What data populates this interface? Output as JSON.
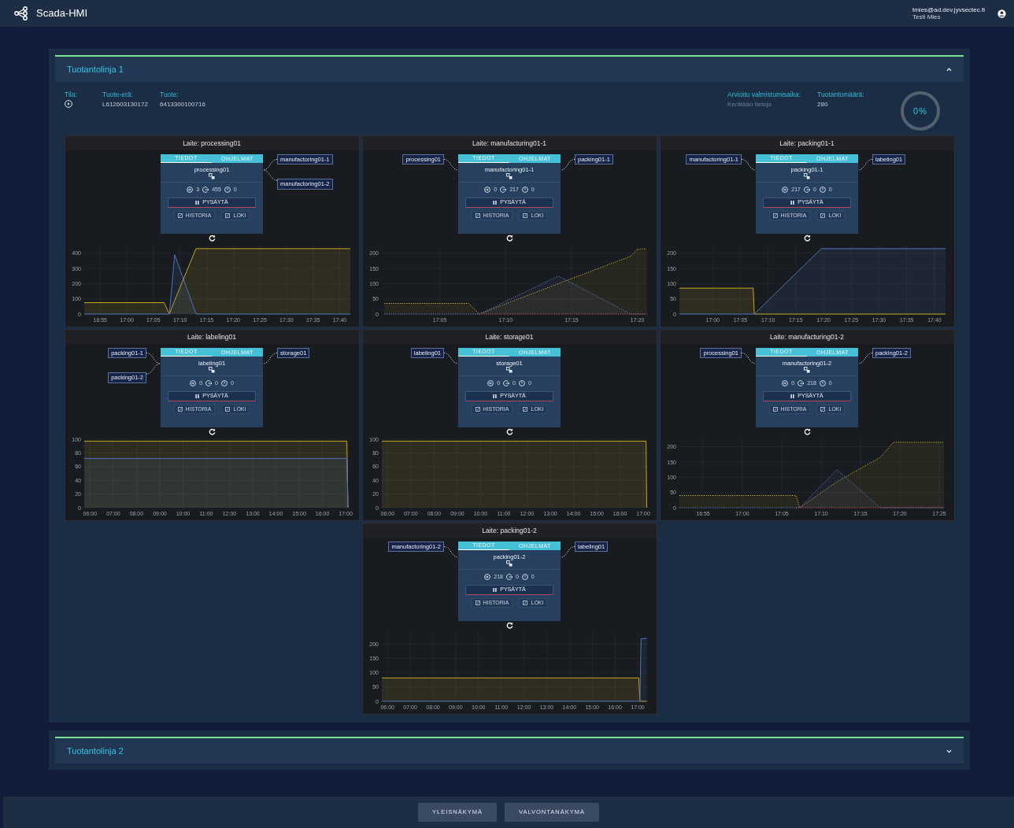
{
  "app": {
    "title": "Scada-HMI"
  },
  "user": {
    "email": "tmies@ad.dev.jyvsectec.fi",
    "name": "Testi Mies"
  },
  "lines": [
    {
      "title": "Tuotantolinja 1",
      "expanded": true,
      "info": {
        "status_label": "Tila:",
        "batch_label": "Tuote-erä:",
        "batch": "L612603130172",
        "product_label": "Tuote:",
        "product": "6413300100716",
        "eta_label": "Arvioitu valmistumisaika:",
        "eta": "Kerätään tietoja",
        "amount_label": "Tuotantomäärä:",
        "amount": "280",
        "progress": {
          "text": "0%"
        }
      },
      "devices": [
        {
          "title": "Laite: processing01",
          "name": "processing01",
          "tabs": [
            {
              "label": "TIEDOT",
              "selected": true
            },
            {
              "label": "OHJELMAT",
              "selected": false
            }
          ],
          "outputs": [
            "manufactoring01-1",
            "manufactoring01-2"
          ],
          "counts": [
            "3",
            "455",
            "0"
          ],
          "stop_button": "PYSÄYTÄ",
          "buttons": [
            "HISTORIA",
            "LOKI"
          ],
          "chart_data": {
            "type": "area",
            "grid": true,
            "x": [
              16.8667,
              17.1167,
              17.1333,
              17.15,
              17.2167,
              17.7
            ],
            "xlim": [
              16.8667,
              17.7
            ],
            "ylim": [
              0,
              450
            ],
            "yticks": [
              0,
              100,
              200,
              300,
              400
            ],
            "xticks": [
              {
                "value": 16.9167,
                "label": "16:55"
              },
              {
                "value": 17,
                "label": "17:00"
              },
              {
                "value": 17.0833,
                "label": "17:05"
              },
              {
                "value": 17.1667,
                "label": "17:10"
              },
              {
                "value": 17.25,
                "label": "17:15"
              },
              {
                "value": 17.3333,
                "label": "17:20"
              },
              {
                "value": 17.4167,
                "label": "17:25"
              },
              {
                "value": 17.5,
                "label": "17:30"
              },
              {
                "value": 17.5833,
                "label": "17:35"
              },
              {
                "value": 17.6667,
                "label": "17:40"
              }
            ],
            "series": [
              {
                "color": "#c9a820",
                "values": [
                  75,
                  75,
                  0,
                  90,
                  430,
                  430
                ]
              },
              {
                "color": "#4d74b8",
                "values": [
                  0,
                  0,
                  0,
                  390,
                  0,
                  0
                ]
              }
            ]
          }
        },
        {
          "title": "Laite: manufacturing01-1",
          "name": "manufactoring01-1",
          "tabs": [
            {
              "label": "TIEDOT",
              "selected": true
            },
            {
              "label": "OHJELMAT",
              "selected": false
            }
          ],
          "inputs": [
            "processing01"
          ],
          "outputs": [
            "packing01-1"
          ],
          "counts": [
            "0",
            "217",
            "0"
          ],
          "stop_button": "PYSÄYTÄ",
          "buttons": [
            "HISTORIA",
            "LOKI"
          ],
          "chart_data": {
            "type": "line",
            "grid": true,
            "x": [
              17.0133,
              17.12,
              17.1333,
              17.2333,
              17.325,
              17.3333,
              17.345
            ],
            "xlim": [
              17.01,
              17.3467
            ],
            "ylim": [
              0,
              225
            ],
            "yticks": [
              0,
              50,
              100,
              150,
              200
            ],
            "xticks": [
              {
                "value": 17.0833,
                "label": "17:05"
              },
              {
                "value": 17.1667,
                "label": "17:10"
              },
              {
                "value": 17.25,
                "label": "17:15"
              },
              {
                "value": 17.3333,
                "label": "17:20"
              }
            ],
            "series": [
              {
                "color": "#d4b62a",
                "line_style": "dotted",
                "values": [
                  35,
                  35,
                  0,
                  100,
                  190,
                  213,
                  215
                ]
              },
              {
                "color": "#5a82c8",
                "line_style": "dotted",
                "values": [
                  0,
                  0,
                  0,
                  125,
                  0,
                  0,
                  0
                ]
              },
              {
                "color": "#d05050",
                "line_style": "dotted",
                "values": [
                  null,
                  null,
                  0,
                  0,
                  0,
                  0,
                  0
                ]
              }
            ]
          }
        },
        {
          "title": "Laite: packing01-1",
          "name": "packing01-1",
          "tabs": [
            {
              "label": "TIEDOT",
              "selected": true
            },
            {
              "label": "OHJELMAT",
              "selected": false
            }
          ],
          "inputs": [
            "manufactoring01-1"
          ],
          "outputs": [
            "labeling01"
          ],
          "counts": [
            "217",
            "0",
            "0"
          ],
          "stop_button": "PYSÄYTÄ",
          "buttons": [
            "HISTORIA",
            "LOKI"
          ],
          "chart_data": {
            "type": "area",
            "grid": true,
            "x": [
              16.9,
              17.1217,
              17.125,
              17.3267,
              17.7
            ],
            "xlim": [
              16.9,
              17.7
            ],
            "ylim": [
              0,
              225
            ],
            "yticks": [
              0,
              50,
              100,
              150,
              200
            ],
            "xticks": [
              {
                "value": 17,
                "label": "17:00"
              },
              {
                "value": 17.0833,
                "label": "17:05"
              },
              {
                "value": 17.1667,
                "label": "17:10"
              },
              {
                "value": 17.25,
                "label": "17:15"
              },
              {
                "value": 17.3333,
                "label": "17:20"
              },
              {
                "value": 17.4167,
                "label": "17:25"
              },
              {
                "value": 17.5,
                "label": "17:30"
              },
              {
                "value": 17.5833,
                "label": "17:35"
              },
              {
                "value": 17.6667,
                "label": "17:40"
              }
            ],
            "series": [
              {
                "color": "#c9a820",
                "values": [
                  85,
                  85,
                  0,
                  0,
                  0
                ]
              },
              {
                "color": "#4d74b8",
                "values": [
                  0,
                  0,
                  0,
                  215,
                  215
                ]
              }
            ]
          }
        },
        {
          "title": "Laite: labeling01",
          "name": "labeling01",
          "tabs": [
            {
              "label": "TIEDOT",
              "selected": true
            },
            {
              "label": "OHJELMAT",
              "selected": false
            }
          ],
          "inputs": [
            "packing01-1",
            "packing01-2"
          ],
          "outputs": [
            "storage01"
          ],
          "counts": [
            "0",
            "0",
            "0"
          ],
          "stop_button": "PYSÄYTÄ",
          "buttons": [
            "HISTORIA",
            "LOKI"
          ],
          "chart_data": {
            "type": "area",
            "grid": true,
            "x": [
              5.75,
              17.05,
              17.1
            ],
            "xlim": [
              5.75,
              17.2
            ],
            "ylim": [
              0,
              100
            ],
            "yticks": [
              0,
              20,
              40,
              60,
              80,
              100
            ],
            "xticks": [
              {
                "value": 6,
                "label": "06:00"
              },
              {
                "value": 7,
                "label": "07:00"
              },
              {
                "value": 8,
                "label": "08:00"
              },
              {
                "value": 9,
                "label": "09:00"
              },
              {
                "value": 10,
                "label": "10:00"
              },
              {
                "value": 11,
                "label": "11:00"
              },
              {
                "value": 12,
                "label": "12:00"
              },
              {
                "value": 13,
                "label": "13:00"
              },
              {
                "value": 14,
                "label": "14:00"
              },
              {
                "value": 15,
                "label": "15:00"
              },
              {
                "value": 16,
                "label": "16:00"
              },
              {
                "value": 17,
                "label": "17:00"
              }
            ],
            "series": [
              {
                "color": "#c9a820",
                "values": [
                  97,
                  97,
                  0
                ]
              },
              {
                "color": "#4d74b8",
                "values": [
                  72,
                  72,
                  0
                ]
              }
            ]
          }
        },
        {
          "title": "Laite: storage01",
          "name": "storage01",
          "tabs": [
            {
              "label": "TIEDOT",
              "selected": true
            },
            {
              "label": "OHJELMAT",
              "selected": false
            }
          ],
          "inputs": [
            "labeling01"
          ],
          "counts": [
            "0",
            "0",
            "0"
          ],
          "stop_button": "PYSÄYTÄ",
          "buttons": [
            "HISTORIA",
            "LOKI"
          ],
          "chart_data": {
            "type": "area",
            "grid": true,
            "x": [
              5.75,
              17.12,
              17.15
            ],
            "xlim": [
              5.75,
              17.2
            ],
            "ylim": [
              0,
              100
            ],
            "yticks": [
              0,
              20,
              40,
              60,
              80,
              100
            ],
            "xticks": [
              {
                "value": 6,
                "label": "06:00"
              },
              {
                "value": 7,
                "label": "07:00"
              },
              {
                "value": 8,
                "label": "08:00"
              },
              {
                "value": 9,
                "label": "09:00"
              },
              {
                "value": 10,
                "label": "10:00"
              },
              {
                "value": 11,
                "label": "11:00"
              },
              {
                "value": 12,
                "label": "12:00"
              },
              {
                "value": 13,
                "label": "13:00"
              },
              {
                "value": 14,
                "label": "14:00"
              },
              {
                "value": 15,
                "label": "15:00"
              },
              {
                "value": 16,
                "label": "16:00"
              },
              {
                "value": 17,
                "label": "17:00"
              }
            ],
            "series": [
              {
                "color": "#c9a820",
                "values": [
                  97,
                  97,
                  0
                ]
              }
            ]
          }
        },
        {
          "title": "Laite: manufacturing01-2",
          "name": "manufactoring01-2",
          "tabs": [
            {
              "label": "TIEDOT",
              "selected": true
            },
            {
              "label": "OHJELMAT",
              "selected": false
            }
          ],
          "inputs": [
            "processing01"
          ],
          "outputs": [
            "packing01-2"
          ],
          "counts": [
            "0",
            "218",
            "0"
          ],
          "stop_button": "PYSÄYTÄ",
          "buttons": [
            "HISTORIA",
            "LOKI"
          ],
          "chart_data": {
            "type": "line",
            "grid": true,
            "x": [
              16.8667,
              17.1133,
              17.1217,
              17.2,
              17.2917,
              17.32,
              17.4267
            ],
            "xlim": [
              16.8667,
              17.43
            ],
            "ylim": [
              0,
              225
            ],
            "yticks": [
              0,
              50,
              100,
              150,
              200
            ],
            "xticks": [
              {
                "value": 16.9167,
                "label": "16:55"
              },
              {
                "value": 17,
                "label": "17:00"
              },
              {
                "value": 17.0833,
                "label": "17:05"
              },
              {
                "value": 17.1667,
                "label": "17:10"
              },
              {
                "value": 17.25,
                "label": "17:15"
              },
              {
                "value": 17.3333,
                "label": "17:20"
              },
              {
                "value": 17.4167,
                "label": "17:25"
              }
            ],
            "series": [
              {
                "color": "#d4b62a",
                "line_style": "dotted",
                "values": [
                  40,
                  40,
                  0,
                  85,
                  165,
                  215,
                  215
                ]
              },
              {
                "color": "#5a82c8",
                "line_style": "dotted",
                "values": [
                  0,
                  0,
                  0,
                  125,
                  0,
                  0,
                  0
                ]
              },
              {
                "color": "#d05050",
                "line_style": "dotted",
                "values": [
                  null,
                  0,
                  0,
                  0,
                  0,
                  0,
                  0
                ]
              }
            ]
          }
        },
        {
          "title": "Laite: packing01-2",
          "name": "packing01-2",
          "tabs": [
            {
              "label": "TIEDOT",
              "selected": true
            },
            {
              "label": "OHJELMAT",
              "selected": false
            }
          ],
          "inputs": [
            "manufactoring01-2"
          ],
          "outputs": [
            "labeling01"
          ],
          "counts": [
            "218",
            "0",
            "0"
          ],
          "stop_button": "PYSÄYTÄ",
          "buttons": [
            "HISTORIA",
            "LOKI"
          ],
          "chart_data": {
            "type": "area",
            "grid": true,
            "x": [
              5.75,
              17.05,
              17.1,
              17.15,
              17.4
            ],
            "xlim": [
              5.75,
              17.45
            ],
            "ylim": [
              0,
              240
            ],
            "yticks": [
              0,
              50,
              100,
              150,
              200
            ],
            "xticks": [
              {
                "value": 6,
                "label": "06:00"
              },
              {
                "value": 7,
                "label": "07:00"
              },
              {
                "value": 8,
                "label": "08:00"
              },
              {
                "value": 9,
                "label": "09:00"
              },
              {
                "value": 10,
                "label": "10:00"
              },
              {
                "value": 11,
                "label": "11:00"
              },
              {
                "value": 12,
                "label": "12:00"
              },
              {
                "value": 13,
                "label": "13:00"
              },
              {
                "value": 14,
                "label": "14:00"
              },
              {
                "value": 15,
                "label": "15:00"
              },
              {
                "value": 16,
                "label": "16:00"
              },
              {
                "value": 17,
                "label": "17:00"
              }
            ],
            "series": [
              {
                "color": "#c9a820",
                "values": [
                  82,
                  82,
                  0,
                  0,
                  0
                ]
              },
              {
                "color": "#4d74b8",
                "values": [
                  0,
                  0,
                  0,
                  220,
                  220
                ]
              }
            ]
          }
        }
      ]
    },
    {
      "title": "Tuotantolinja 2",
      "expanded": false
    }
  ],
  "footer_buttons": [
    "YLEISNÄKYMÄ",
    "VALVONTANÄKYMÄ"
  ]
}
